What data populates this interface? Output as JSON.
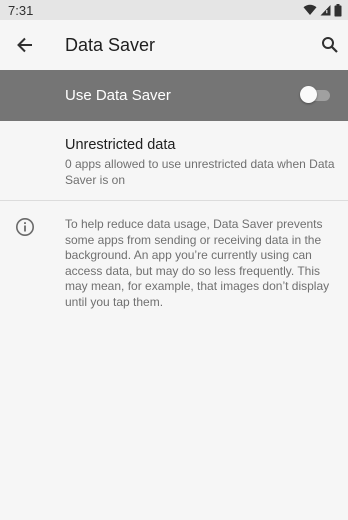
{
  "status_bar": {
    "time": "7:31",
    "icons": [
      "wifi-icon",
      "cell-signal-icon",
      "battery-icon"
    ]
  },
  "app_bar": {
    "title": "Data Saver",
    "back_icon": "arrow-back-icon",
    "search_icon": "search-icon"
  },
  "master_switch": {
    "label": "Use Data Saver",
    "checked": false,
    "background": "#757575"
  },
  "unrestricted": {
    "title": "Unrestricted data",
    "summary": "0 apps allowed to use unrestricted data when Data Saver is on"
  },
  "footer": {
    "icon": "info-icon",
    "text": "To help reduce data usage, Data Saver prevents some apps from sending or receiving data in the background. An app you’re currently using can access data, but may do so less frequently. This may mean, for example, that images don’t display until you tap them."
  }
}
